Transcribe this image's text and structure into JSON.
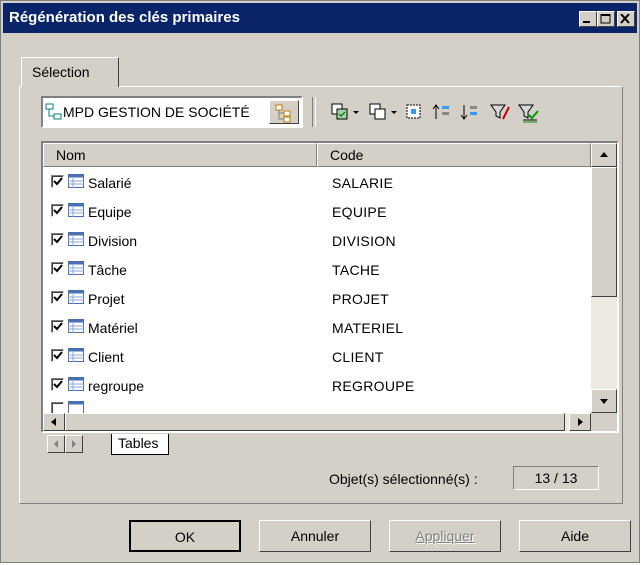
{
  "window": {
    "title": "Régénération des clés primaires"
  },
  "tabs": [
    {
      "label": "Sélection"
    }
  ],
  "model_selector": {
    "value": "MPD GESTION DE SOCIÉTÉ"
  },
  "toolbar": {
    "icons": [
      "select-all-icon",
      "dropdown-arrow-icon",
      "deselect-all-icon",
      "dropdown-arrow-icon",
      "select-current-icon",
      "move-up-icon",
      "move-down-icon",
      "filter-icon",
      "clear-filter-icon"
    ]
  },
  "grid": {
    "columns": [
      "Nom",
      "Code"
    ],
    "rows": [
      {
        "name": "Salarié",
        "code": "SALARIE",
        "checked": true
      },
      {
        "name": "Equipe",
        "code": "EQUIPE",
        "checked": true
      },
      {
        "name": "Division",
        "code": "DIVISION",
        "checked": true
      },
      {
        "name": "Tâche",
        "code": "TACHE",
        "checked": true
      },
      {
        "name": "Projet",
        "code": "PROJET",
        "checked": true
      },
      {
        "name": "Matériel",
        "code": "MATERIEL",
        "checked": true
      },
      {
        "name": "Client",
        "code": "CLIENT",
        "checked": true
      },
      {
        "name": "regroupe",
        "code": "REGROUPE",
        "checked": true
      }
    ]
  },
  "sheet_tabs": [
    {
      "label": "Tables"
    }
  ],
  "status": {
    "label": "Objet(s) sélectionné(s) :",
    "count": "13 / 13"
  },
  "buttons": {
    "ok": "OK",
    "cancel": "Annuler",
    "apply": "Appliquer",
    "help": "Aide"
  },
  "colors": {
    "titlebar": "#0a246a",
    "face": "#d4d0c8"
  }
}
